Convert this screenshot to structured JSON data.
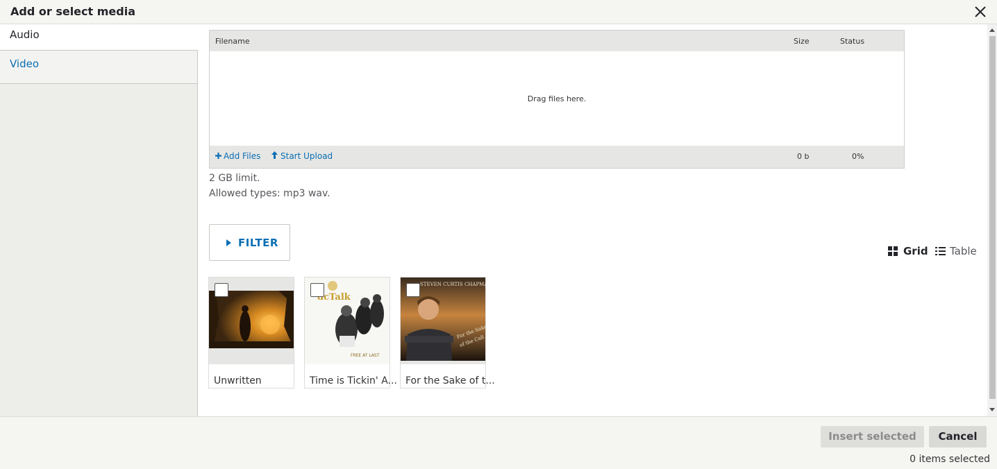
{
  "dialog": {
    "title": "Add or select media"
  },
  "tabs": [
    {
      "label": "Audio"
    },
    {
      "label": "Video"
    }
  ],
  "uploader": {
    "col_filename": "Filename",
    "col_size": "Size",
    "col_status": "Status",
    "drop_text": "Drag files here.",
    "add_files": "Add Files",
    "start_upload": "Start Upload",
    "total_size": "0 b",
    "total_percent": "0%"
  },
  "limits": {
    "size": "2 GB limit.",
    "types": "Allowed types: mp3 wav."
  },
  "filter": {
    "label": "FILTER"
  },
  "views": {
    "grid": "Grid",
    "table": "Table"
  },
  "media": [
    {
      "name": "Unwritten",
      "checked": false
    },
    {
      "name": "Time is Tickin' A...",
      "checked": false
    },
    {
      "name": "For the Sake of t...",
      "checked": false
    }
  ],
  "actions": {
    "insert": "Insert selected",
    "cancel": "Cancel",
    "selected_count": "0 items selected"
  }
}
